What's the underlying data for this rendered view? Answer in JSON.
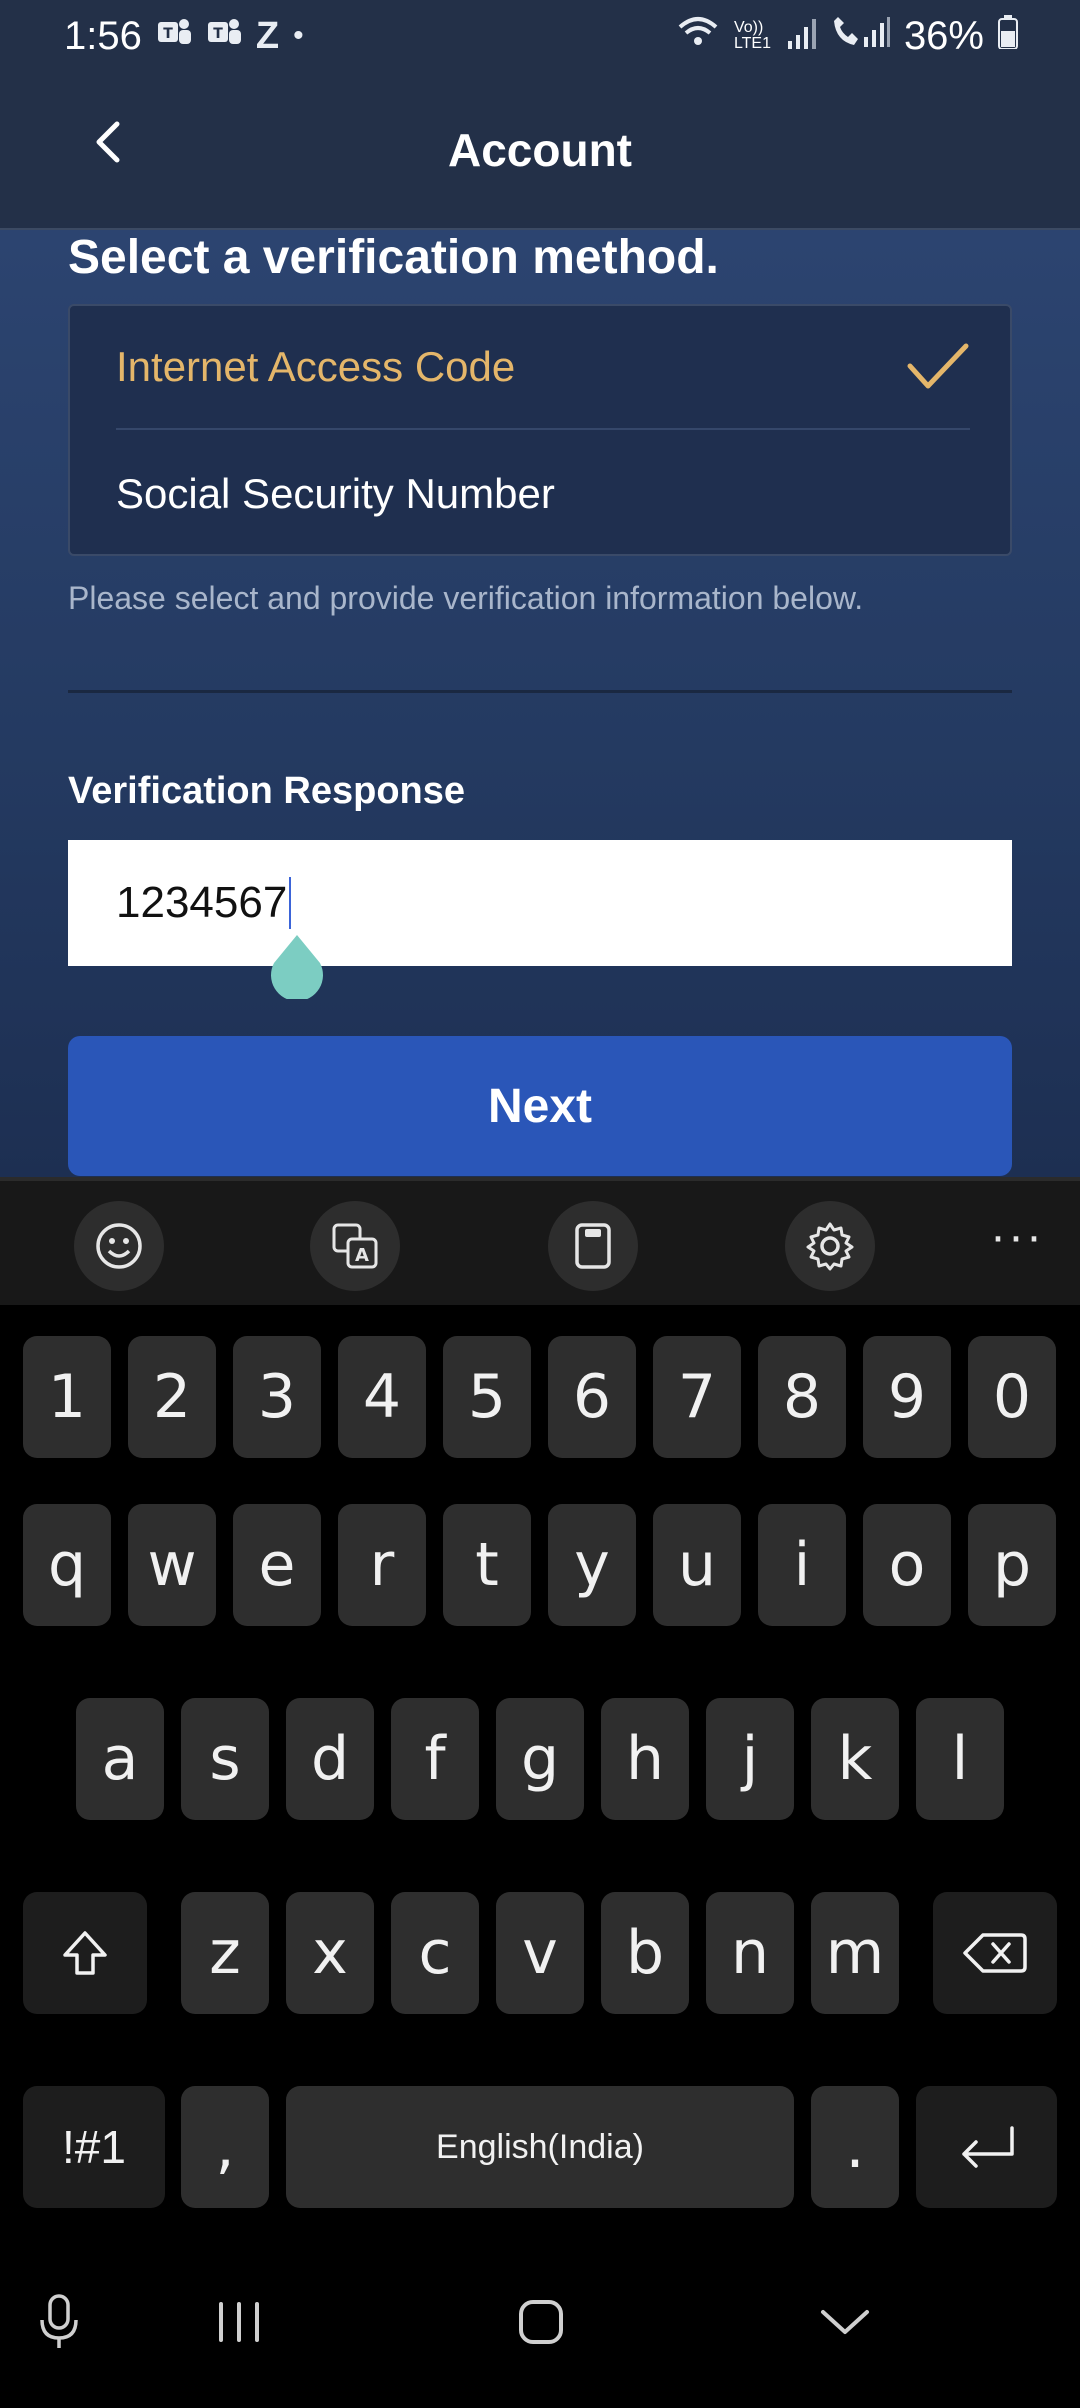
{
  "status_bar": {
    "time": "1:56",
    "left_icons": [
      "teams-icon",
      "teams-icon",
      "z-app-icon",
      "dot"
    ],
    "network": "Vo)) LTE1",
    "battery": "36%"
  },
  "app_bar": {
    "title": "Account"
  },
  "verification": {
    "heading": "Select a verification method.",
    "options": [
      {
        "label": "Internet Access Code",
        "selected": true
      },
      {
        "label": "Social Security Number",
        "selected": false
      }
    ],
    "helper": "Please select and provide verification information below."
  },
  "response_field": {
    "label": "Verification Response",
    "value": "1234567"
  },
  "next_button": {
    "label": "Next"
  },
  "keyboard": {
    "toolbar": [
      "emoji-icon",
      "translate-icon",
      "clipboard-icon",
      "gear-icon",
      "more-icon"
    ],
    "number_row": [
      "1",
      "2",
      "3",
      "4",
      "5",
      "6",
      "7",
      "8",
      "9",
      "0"
    ],
    "row1": [
      "q",
      "w",
      "e",
      "r",
      "t",
      "y",
      "u",
      "i",
      "o",
      "p"
    ],
    "row2": [
      "a",
      "s",
      "d",
      "f",
      "g",
      "h",
      "j",
      "k",
      "l"
    ],
    "row3": [
      "z",
      "x",
      "c",
      "v",
      "b",
      "n",
      "m"
    ],
    "symbols_key": "!#1",
    "comma_key": ",",
    "space_key": "English(India)",
    "period_key": "."
  },
  "colors": {
    "selected_option": "#e4b66a",
    "button": "#2a56b8",
    "header": "#233048"
  }
}
